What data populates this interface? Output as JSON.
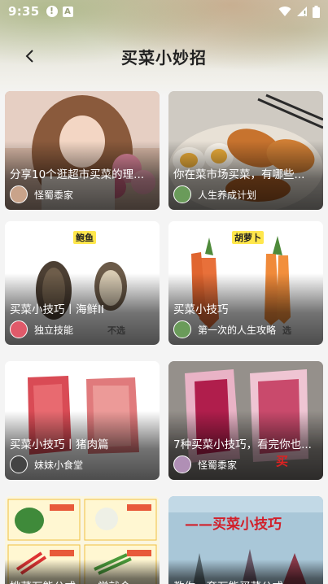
{
  "status_bar": {
    "time": "9:35",
    "icons": [
      "alert-icon",
      "a-notification-icon",
      "wifi-icon",
      "signal-icon",
      "battery-icon"
    ]
  },
  "header": {
    "title": "买菜小妙招",
    "back_icon": "chevron-left-icon"
  },
  "cards": [
    {
      "title": "分享10个逛超市买菜的理...",
      "author": "怪蜀黍家",
      "avatar_color": "#c9a38a"
    },
    {
      "title": "你在菜市场买菜，有哪些...",
      "author": "人生养成计划",
      "avatar_color": "#6a9b5a"
    },
    {
      "title": "买菜小技巧丨海鲜II",
      "author": "独立技能",
      "avatar_color": "#e05a6a",
      "overlay_label": "鲍鱼",
      "side_label": "不选"
    },
    {
      "title": "买菜小技巧",
      "author": "第一次的人生攻略",
      "avatar_color": "#6a9b5a",
      "overlay_label": "胡萝卜",
      "side_label": "选"
    },
    {
      "title": "买菜小技巧丨猪肉篇",
      "author": "妹妹小食堂",
      "avatar_color": "#444444"
    },
    {
      "title": "7种买菜小技巧，看完你也...",
      "author": "怪蜀黍家",
      "avatar_color": "#b08fb5",
      "side_label": "买"
    },
    {
      "title": "挑菜万能公式，一学就会",
      "author": "",
      "avatar_color": ""
    },
    {
      "title": "教你一套万能买菜公式，...",
      "author": "",
      "avatar_color": "",
      "banner": "——买菜小技巧"
    }
  ]
}
